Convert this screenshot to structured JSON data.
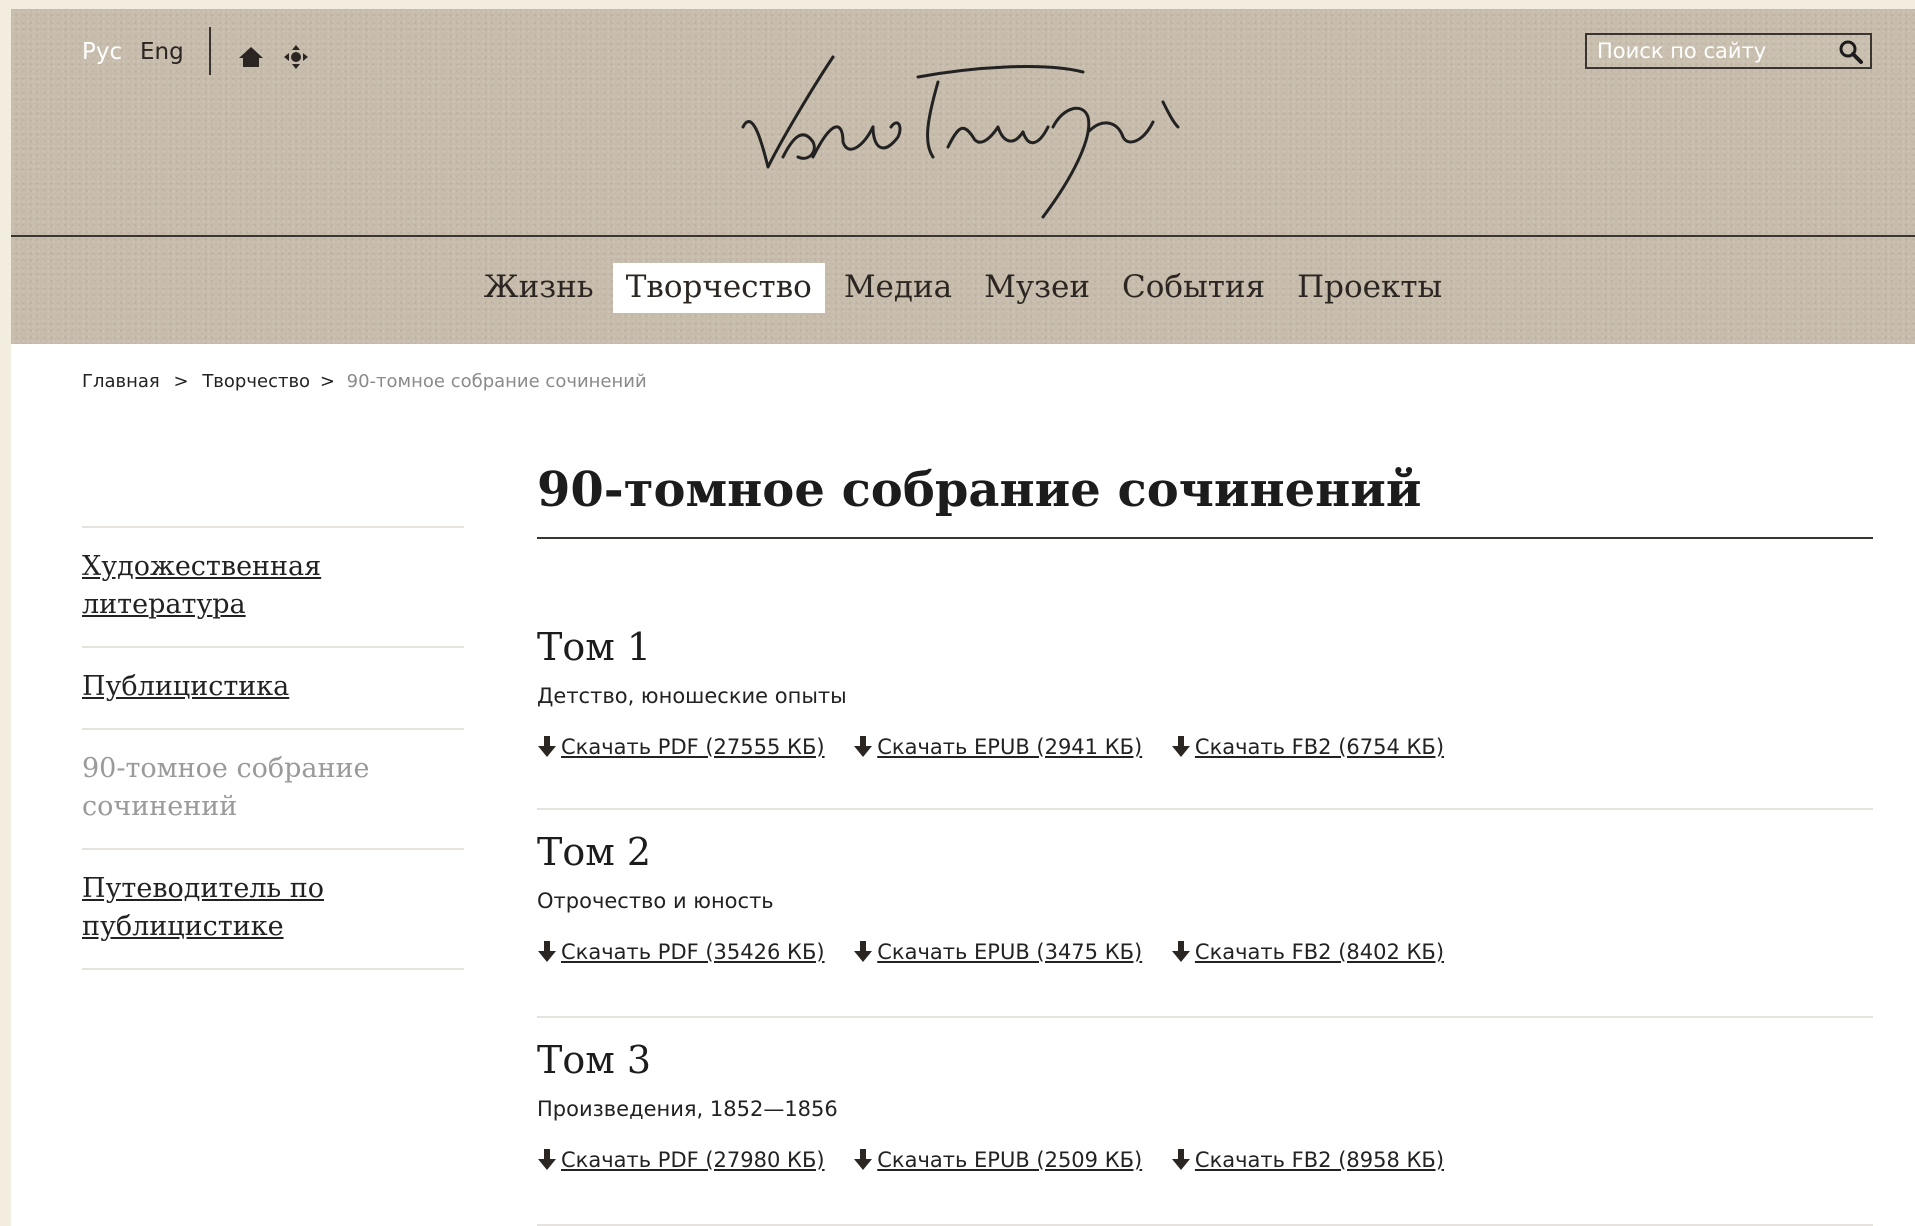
{
  "header": {
    "languages": {
      "ru": "Рус",
      "en": "Eng"
    },
    "logo_alt": "Лев Толстой",
    "search": {
      "placeholder": "Поиск по сайту"
    },
    "icons": {
      "home": "home-icon",
      "sitemap": "sitemap-icon",
      "search": "search-icon"
    }
  },
  "nav": {
    "items": [
      {
        "label": "Жизнь",
        "active": false
      },
      {
        "label": "Творчество",
        "active": true
      },
      {
        "label": "Медиа",
        "active": false
      },
      {
        "label": "Музеи",
        "active": false
      },
      {
        "label": "События",
        "active": false
      },
      {
        "label": "Проекты",
        "active": false
      }
    ]
  },
  "breadcrumb": {
    "items": [
      "Главная",
      "Творчество"
    ],
    "separator": ">",
    "current": "90-томное собрание сочинений"
  },
  "sidebar": {
    "items": [
      {
        "label": "Художественная литература",
        "current": false
      },
      {
        "label": "Публицистика",
        "current": false
      },
      {
        "label": "90-томное собрание сочинений",
        "current": true
      },
      {
        "label": "Путеводитель по публицистике",
        "current": false
      }
    ]
  },
  "main": {
    "title": "90-томное собрание сочинений",
    "volumes": [
      {
        "title": "Том 1",
        "subtitle": "Детство, юношеские опыты",
        "downloads": [
          "Скачать PDF (27555 КБ)",
          "Скачать EPUB (2941 КБ)",
          "Скачать FB2 (6754 КБ)"
        ]
      },
      {
        "title": "Том 2",
        "subtitle": "Отрочество и юность",
        "downloads": [
          "Скачать PDF (35426 КБ)",
          "Скачать EPUB (3475 КБ)",
          "Скачать FB2 (8402 КБ)"
        ]
      },
      {
        "title": "Том 3",
        "subtitle": "Произведения, 1852—1856",
        "downloads": [
          "Скачать PDF (27980 КБ)",
          "Скачать EPUB (2509 КБ)",
          "Скачать FB2 (8958 КБ)"
        ]
      }
    ]
  },
  "colors": {
    "header_bg": "#c7bcab",
    "page_bg": "#f3ede0",
    "text": "#222222",
    "muted": "#8a8a8a"
  }
}
